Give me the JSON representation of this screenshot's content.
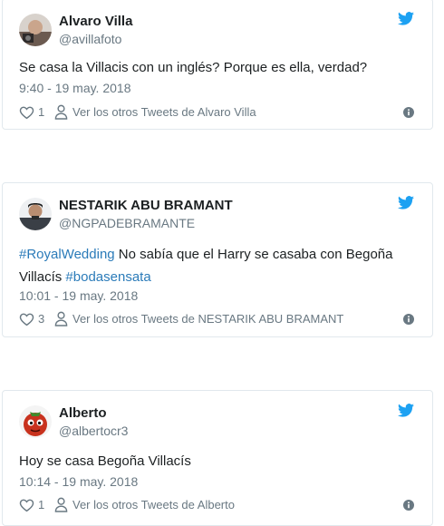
{
  "colors": {
    "link": "#2b7bb9",
    "secondary": "#697882",
    "bird": "#1da1f2",
    "border": "#e1e8ed"
  },
  "tweets": [
    {
      "author": "Alvaro Villa",
      "handle": "@avillafoto",
      "text": [
        {
          "t": "Se casa la Villacis con un inglés? Porque es ella, verdad?",
          "tag": false
        }
      ],
      "timestamp": "9:40 - 19 may. 2018",
      "likes": "1",
      "other_tweets": "Ver los otros Tweets de Alvaro Villa"
    },
    {
      "author": "NESTARIK ABU BRAMANT",
      "handle": "@NGPADEBRAMANTE",
      "text": [
        {
          "t": "#RoyalWedding",
          "tag": true
        },
        {
          "t": " No sabía que el Harry se casaba con Begoña Villacís ",
          "tag": false
        },
        {
          "t": "#bodasensata",
          "tag": true
        }
      ],
      "timestamp": "10:01 - 19 may. 2018",
      "likes": "3",
      "other_tweets": "Ver los otros Tweets de NESTARIK ABU BRAMANT"
    },
    {
      "author": "Alberto",
      "handle": "@albertocr3",
      "text": [
        {
          "t": "Hoy se casa Begoña Villacís",
          "tag": false
        }
      ],
      "timestamp": "10:14 - 19 may. 2018",
      "likes": "1",
      "other_tweets": "Ver los otros Tweets de Alberto"
    }
  ]
}
